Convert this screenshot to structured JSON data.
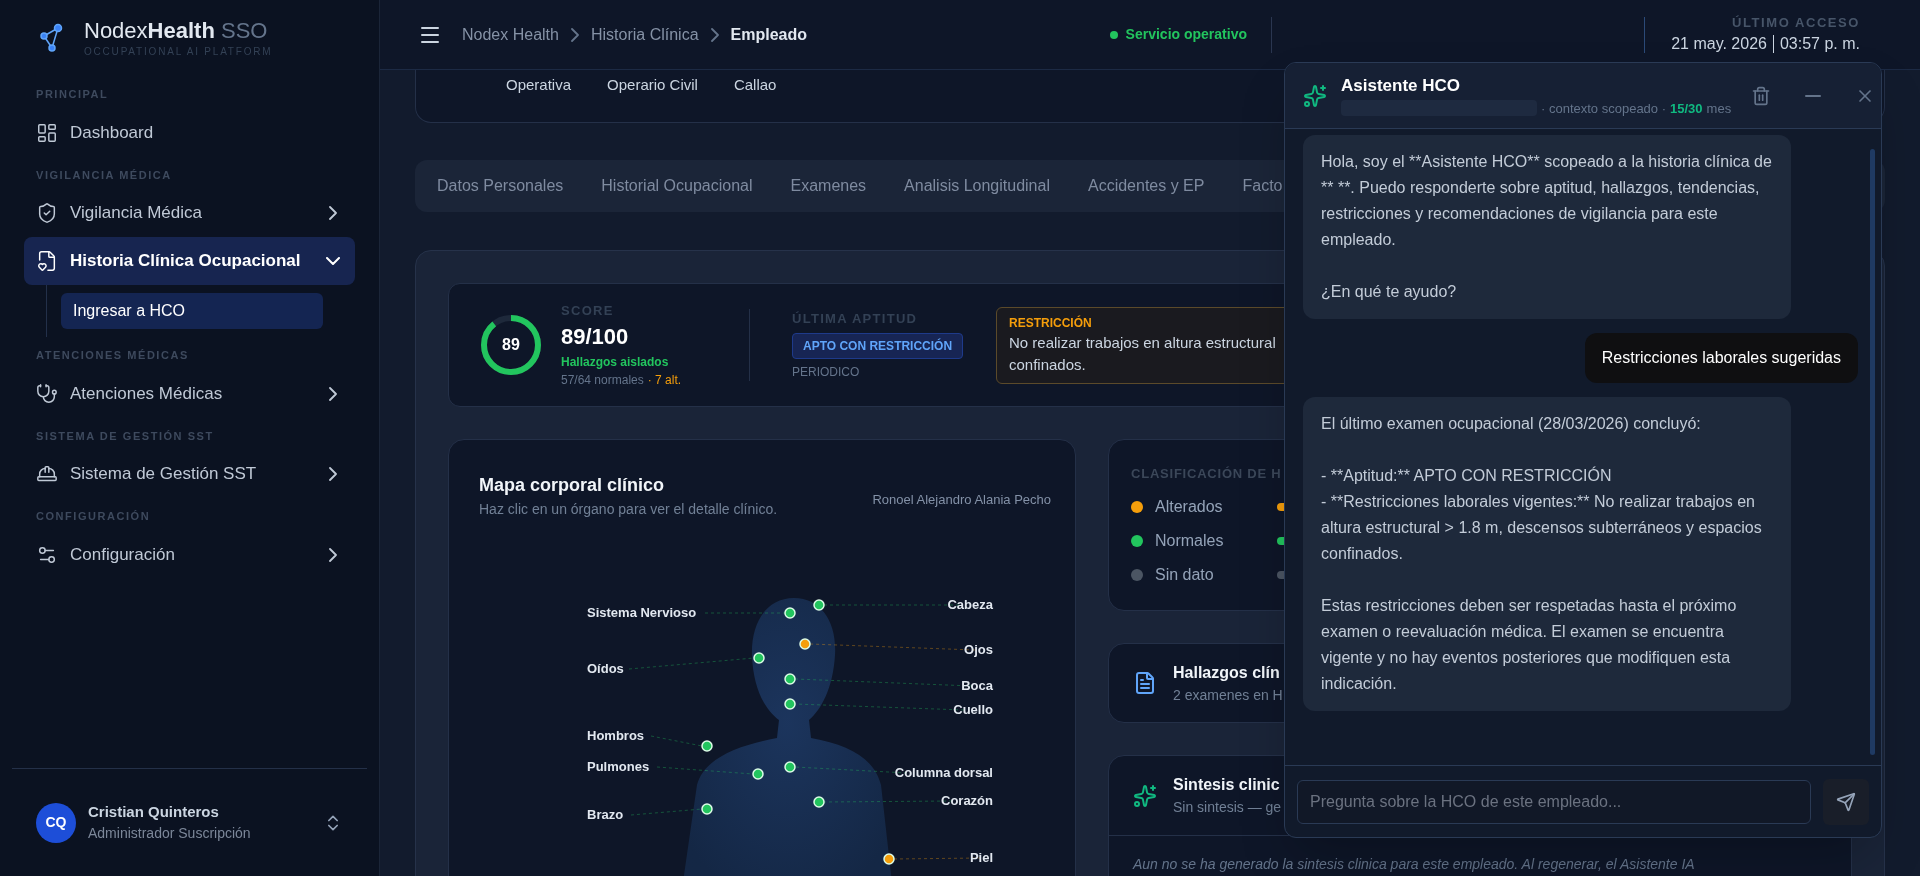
{
  "brand": {
    "name": "Nodex",
    "emphasis": "Health",
    "suffix": "SSO",
    "tagline": "OCCUPATIONAL AI PLATFORM"
  },
  "sidebar": {
    "sections": [
      {
        "title": "PRINCIPAL",
        "items": [
          {
            "label": "Dashboard",
            "kind": "link",
            "selected": false
          }
        ]
      },
      {
        "title": "VIGILANCIA MÉDICA",
        "items": [
          {
            "label": "Vigilancia Médica",
            "kind": "group",
            "selected": false,
            "expanded": false
          },
          {
            "label": "Historia Clínica Ocupacional",
            "kind": "group",
            "selected": true,
            "expanded": true,
            "children": [
              {
                "label": "Ingresar a HCO",
                "selected": true
              }
            ]
          }
        ]
      },
      {
        "title": "ATENCIONES MÉDICAS",
        "items": [
          {
            "label": "Atenciones Médicas",
            "kind": "group",
            "selected": false,
            "expanded": false
          }
        ]
      },
      {
        "title": "SISTEMA DE GESTIÓN SST",
        "items": [
          {
            "label": "Sistema de Gestión SST",
            "kind": "group",
            "selected": false,
            "expanded": false
          }
        ]
      },
      {
        "title": "CONFIGURACIÓN",
        "items": [
          {
            "label": "Configuración",
            "kind": "group",
            "selected": false,
            "expanded": false
          }
        ]
      }
    ]
  },
  "user": {
    "initials": "CQ",
    "name": "Cristian Quinteros",
    "role": "Administrador Suscripción"
  },
  "header": {
    "breadcrumb": [
      "Nodex Health",
      "Historia Clínica",
      "Empleado"
    ],
    "status": {
      "text": "Servicio operativo",
      "ok": true
    },
    "last_access": {
      "label": "ÚLTIMO ACCESO",
      "date": "21 may. 2026",
      "time": "03:57 p. m."
    }
  },
  "employee_card": {
    "fields": [
      "Operativa",
      "Operario Civil",
      "Callao"
    ]
  },
  "tabs": [
    {
      "label": "Datos Personales"
    },
    {
      "label": "Historial Ocupacional"
    },
    {
      "label": "Examenes"
    },
    {
      "label": "Analisis Longitudinal"
    },
    {
      "label": "Accidentes y EP"
    },
    {
      "label": "Facto"
    }
  ],
  "score": {
    "label": "SCORE",
    "value": "89",
    "display": "89/100",
    "level": 0.89,
    "summary": "Hallazgos aislados",
    "normals": "57/64 normales",
    "altered": "· 7 alt."
  },
  "aptitude": {
    "label": "ÚLTIMA APTITUD",
    "badge": "APTO CON RESTRICCIÓN",
    "exam_type": "PERIODICO"
  },
  "restriction": {
    "title": "RESTRICCIÓN",
    "lines": [
      "No realizar trabajos en altura estructural",
      "confinados."
    ]
  },
  "body_map": {
    "title": "Mapa corporal clínico",
    "subtitle": "Haz clic en un órgano para ver el detalle clínico.",
    "patient": "Ronoel Alejandro Alania Pecho",
    "organs": [
      {
        "name": "Cabeza",
        "color": "#22c55e"
      },
      {
        "name": "Sistema Nervioso",
        "color": "#22c55e"
      },
      {
        "name": "Ojos",
        "color": "#f59e0b"
      },
      {
        "name": "Oídos",
        "color": "#22c55e"
      },
      {
        "name": "Boca",
        "color": "#22c55e"
      },
      {
        "name": "Cuello",
        "color": "#22c55e"
      },
      {
        "name": "Hombros",
        "color": "#22c55e"
      },
      {
        "name": "Pulmones",
        "color": "#22c55e"
      },
      {
        "name": "Columna dorsal",
        "color": "#22c55e"
      },
      {
        "name": "Corazón",
        "color": "#22c55e"
      },
      {
        "name": "Brazo",
        "color": "#22c55e"
      },
      {
        "name": "Piel",
        "color": "#f59e0b"
      }
    ]
  },
  "classification": {
    "title": "CLASIFICACIÓN DE H",
    "items": [
      {
        "label": "Alterados",
        "color": "#f59e0b"
      },
      {
        "label": "Normales",
        "color": "#22c55e"
      },
      {
        "label": "Sin dato",
        "color": "#4b5563"
      }
    ]
  },
  "findings_card": {
    "title": "Hallazgos clín",
    "subtitle": "2 examenes en H"
  },
  "synthesis_card": {
    "title": "Sintesis clinic",
    "subtitle": "Sin sintesis — ge",
    "note": "Aun no se ha generado la sintesis clinica para este empleado. Al regenerar, el Asistente IA"
  },
  "chat": {
    "title": "Asistente HCO",
    "context": "· contexto scopeado ·",
    "quota": "15/30",
    "quota_unit": "mes",
    "messages": [
      {
        "kind": "assistant",
        "text": "Hola, soy el **Asistente HCO** scopeado a la historia clínica de ** **. Puedo responderte sobre aptitud, hallazgos, tendencias, restricciones y recomendaciones de vigilancia para este empleado.\n\n¿En qué te ayudo?"
      },
      {
        "kind": "user",
        "text": "Restricciones laborales sugeridas"
      },
      {
        "kind": "assistant",
        "text": "El último examen ocupacional (28/03/2026) concluyó:\n\n- **Aptitud:** APTO CON RESTRICCIÓN\n- **Restricciones laborales vigentes:** No realizar trabajos en altura estructural > 1.8 m, descensos subterráneos y espacios confinados.\n\nEstas restricciones deben ser respetadas hasta el próximo examen o reevaluación médica. El examen se encuentra vigente y no hay eventos posteriores que modifiquen esta indicación."
      }
    ],
    "input": {
      "placeholder": "Pregunta sobre la HCO de este empleado..."
    }
  }
}
